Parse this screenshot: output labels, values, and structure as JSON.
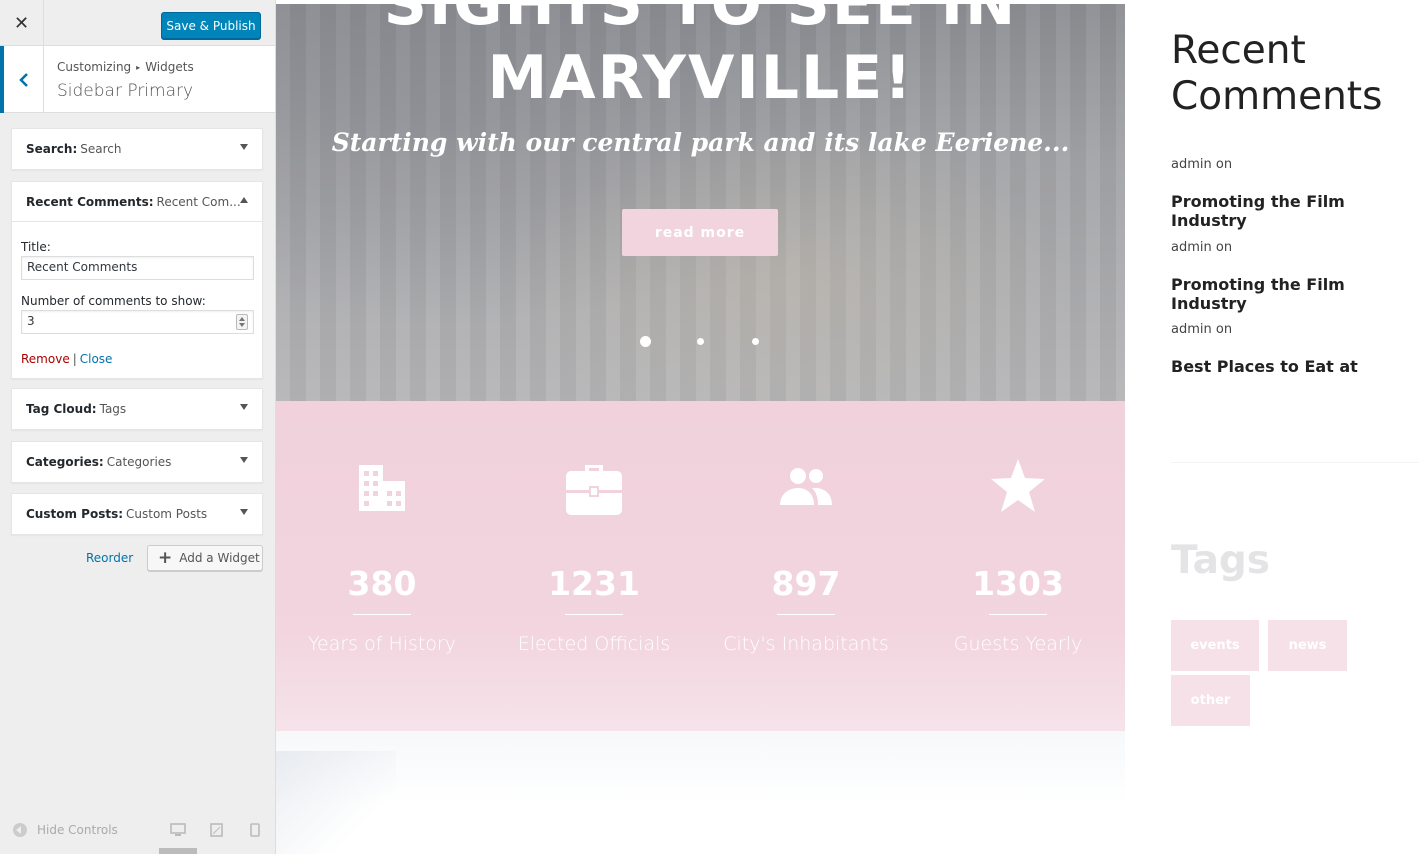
{
  "customizer": {
    "close_label": "✕",
    "publish_label": "Save & Publish",
    "breadcrumb": [
      "Customizing",
      "Widgets"
    ],
    "breadcrumb_sep": "▸",
    "section_title": "Sidebar Primary",
    "widgets": [
      {
        "type": "Search:",
        "title": "Search"
      },
      {
        "type": "Recent Comments:",
        "title": "Recent Com..."
      },
      {
        "type": "Tag Cloud:",
        "title": "Tags"
      },
      {
        "type": "Categories:",
        "title": "Categories"
      },
      {
        "type": "Custom Posts:",
        "title": "Custom Posts"
      }
    ],
    "recent_comments_form": {
      "title_label": "Title:",
      "title_value": "Recent Comments",
      "number_label": "Number of comments to show:",
      "number_value": "3",
      "remove_label": "Remove",
      "pipe": "|",
      "close_label": "Close"
    },
    "reorder_label": "Reorder",
    "add_widget_label": "Add a Widget",
    "hide_controls_label": "Hide Controls"
  },
  "preview": {
    "hero": {
      "title_line1": "SIGHTS TO SEE IN",
      "title_line2": "MARYVILLE!",
      "subtitle": "Starting with our central park and its lake Eeriene...",
      "button_label": "read more",
      "slide_count": 3,
      "active_slide": 1
    },
    "stats": [
      {
        "icon": "building-icon",
        "number": "380",
        "label": "Years of History"
      },
      {
        "icon": "briefcase-icon",
        "number": "1231",
        "label": "Elected Officials"
      },
      {
        "icon": "people-icon",
        "number": "897",
        "label": "City's Inhabitants"
      },
      {
        "icon": "star-icon",
        "number": "1303",
        "label": "Guests Yearly"
      }
    ],
    "sidebar": {
      "recent_comments_title": "Recent Comments",
      "comments": [
        {
          "meta": "admin on",
          "post": "Promoting the Film Industry"
        },
        {
          "meta": "admin on",
          "post": "Promoting the Film Industry"
        },
        {
          "meta": "admin on",
          "post": "Best Places to Eat at"
        }
      ],
      "tags_title": "Tags",
      "tags": [
        "events",
        "news",
        "other"
      ]
    }
  },
  "colors": {
    "wp_blue": "#0085ba",
    "link_blue": "#0073aa",
    "remove_red": "#aa0000",
    "pink": "#f2d4df"
  }
}
